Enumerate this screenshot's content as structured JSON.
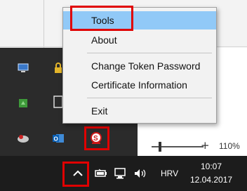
{
  "menu": {
    "items": [
      {
        "label": "Tools",
        "highlighted": true
      },
      {
        "label": "About"
      },
      {
        "label": "Change Token Password"
      },
      {
        "label": "Certificate Information"
      },
      {
        "label": "Exit"
      }
    ]
  },
  "statusbar": {
    "zoom_level": "110%",
    "zoom_plus": "+"
  },
  "taskbar": {
    "language": "HRV",
    "time": "10:07",
    "date": "12.04.2017",
    "chevron": "^"
  },
  "tray_icons": [
    "monitor-icon",
    "lock-icon",
    "green-app-icon",
    "blank-app-icon",
    "wrench-icon",
    "outlook-icon",
    "token-app-icon"
  ],
  "colors": {
    "highlight": "#91c9f7",
    "annotation_red": "#e00000",
    "taskbar": "#1c1c1c",
    "overflow_panel": "#2b2b2b"
  }
}
